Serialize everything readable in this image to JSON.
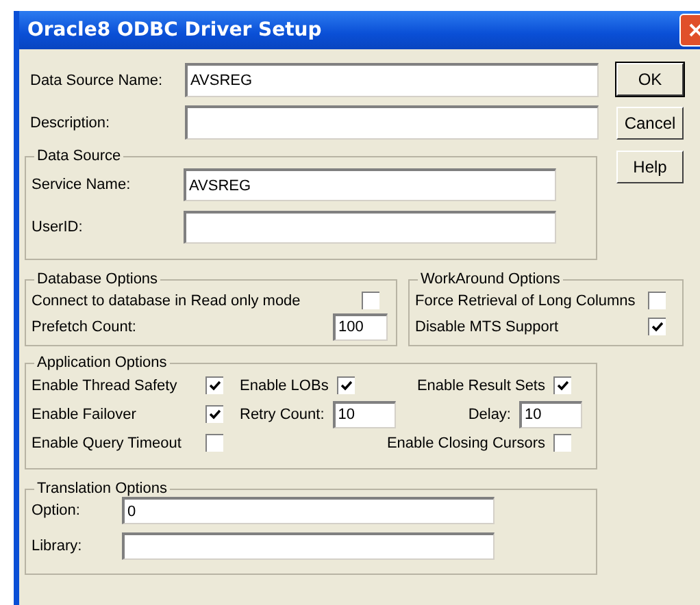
{
  "window": {
    "title": "Oracle8 ODBC Driver Setup"
  },
  "fields": [
    {
      "label": "Data Source Name:",
      "value": "AVSREG"
    },
    {
      "label": "Description:"
    }
  ],
  "buttons": [
    {
      "label": "OK",
      "default": true
    },
    {
      "label": "Cancel",
      "default": false
    },
    {
      "label": "Help",
      "default": false
    }
  ],
  "data_source": {
    "title": "Data Source",
    "fields": [
      {
        "label": "Service Name:",
        "value": "AVSREG"
      },
      {
        "label": "UserID:"
      }
    ]
  },
  "database_options": {
    "title": "Database Options",
    "items": [
      {
        "kind": "checkbox",
        "label": "Connect to database in Read only mode",
        "checked": false
      },
      {
        "kind": "input",
        "label": "Prefetch Count:",
        "value": "100"
      }
    ]
  },
  "workaround_options": {
    "title": "WorkAround Options",
    "items": [
      {
        "kind": "checkbox",
        "label": "Force Retrieval of Long Columns",
        "checked": false
      },
      {
        "kind": "checkbox",
        "label": "Disable MTS Support",
        "checked": true
      }
    ]
  },
  "application_options": {
    "title": "Application Options",
    "rows": [
      [
        {
          "kind": "checkbox",
          "label": "Enable Thread Safety",
          "checked": true
        },
        {
          "kind": "checkbox",
          "label": "Enable LOBs",
          "checked": true
        },
        {
          "kind": "checkbox",
          "label": "Enable Result Sets",
          "checked": true
        }
      ],
      [
        {
          "kind": "checkbox",
          "label": "Enable Failover",
          "checked": true
        },
        {
          "kind": "input",
          "label": "Retry Count:",
          "value": "10"
        },
        {
          "kind": "input",
          "label": "Delay:",
          "value": "10"
        }
      ],
      [
        {
          "kind": "checkbox",
          "label": "Enable Query Timeout",
          "checked": false
        },
        "",
        {
          "kind": "checkbox",
          "label": "Enable Closing Cursors",
          "checked": false
        }
      ]
    ]
  },
  "translation_options": {
    "title": "Translation Options",
    "fields": [
      {
        "label": "Option:",
        "value": "0"
      },
      {
        "label": "Library:"
      }
    ]
  }
}
